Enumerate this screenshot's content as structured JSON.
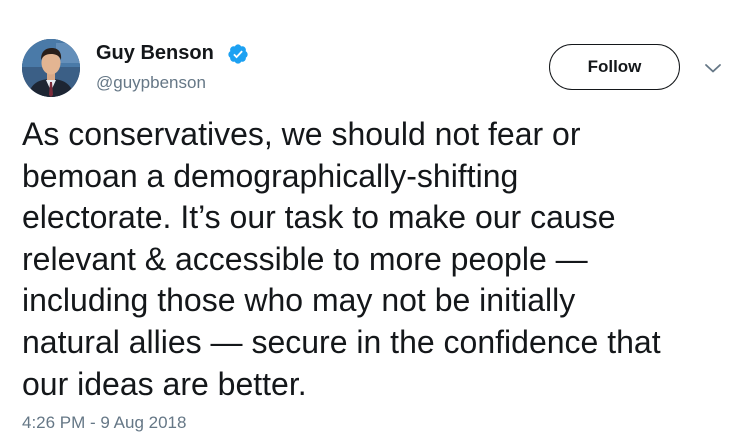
{
  "author": {
    "display_name": "Guy Benson",
    "handle": "@guypbenson",
    "verified": true,
    "avatar_icon": "profile-photo",
    "badge_color": "#1da1f2"
  },
  "actions": {
    "follow_label": "Follow",
    "more_icon": "chevron-down-icon"
  },
  "tweet": {
    "text": "As conservatives, we should not fear or\nbemoan a demographically-shifting\nelectorate. It’s our task to make our cause\nrelevant & accessible to more people —\nincluding those who may not be initially\nnatural allies — secure in the confidence that\nour ideas are better.",
    "timestamp": "4:26 PM - 9 Aug 2018"
  }
}
